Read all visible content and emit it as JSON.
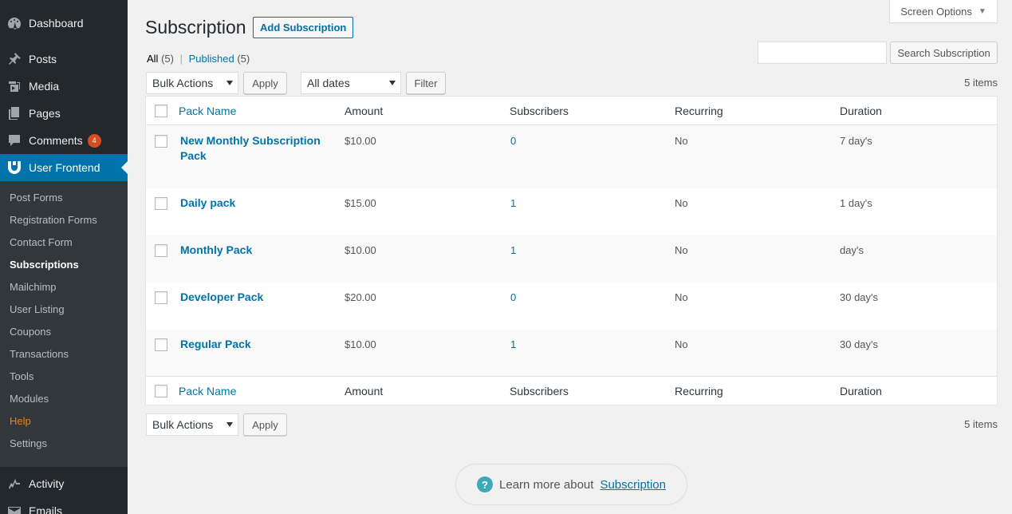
{
  "sidebar": {
    "menu": [
      {
        "label": "Dashboard",
        "icon": "dashboard-icon"
      },
      {
        "label": "Posts",
        "icon": "pin-icon"
      },
      {
        "label": "Media",
        "icon": "media-icon"
      },
      {
        "label": "Pages",
        "icon": "pages-icon"
      },
      {
        "label": "Comments",
        "icon": "comment-icon",
        "badge": "4"
      },
      {
        "label": "User Frontend",
        "icon": "user-frontend-icon"
      }
    ],
    "submenu": [
      "Post Forms",
      "Registration Forms",
      "Contact Form",
      "Subscriptions",
      "Mailchimp",
      "User Listing",
      "Coupons",
      "Transactions",
      "Tools",
      "Modules",
      "Help",
      "Settings"
    ],
    "bottom_menu": [
      {
        "label": "Activity",
        "icon": "activity-icon"
      },
      {
        "label": "Emails",
        "icon": "email-icon"
      }
    ]
  },
  "header": {
    "screen_options": "Screen Options",
    "title": "Subscription",
    "add_new": "Add Subscription"
  },
  "views": {
    "all": "All",
    "all_count": "(5)",
    "separator": "|",
    "published": "Published",
    "published_count": "(5)"
  },
  "search": {
    "value": "",
    "button": "Search Subscription"
  },
  "tablenav_top": {
    "bulk_actions": "Bulk Actions",
    "apply": "Apply",
    "dates": "All dates",
    "filter": "Filter",
    "items": "5 items"
  },
  "tablenav_bottom": {
    "bulk_actions": "Bulk Actions",
    "apply": "Apply",
    "items": "5 items"
  },
  "table": {
    "columns": [
      "Pack Name",
      "Amount",
      "Subscribers",
      "Recurring",
      "Duration"
    ],
    "rows": [
      {
        "name": "New Monthly Subscription Pack",
        "amount": "$10.00",
        "subscribers": "0",
        "recurring": "No",
        "duration": "7 day's"
      },
      {
        "name": "Daily pack",
        "amount": "$15.00",
        "subscribers": "1",
        "recurring": "No",
        "duration": "1 day's"
      },
      {
        "name": "Monthly Pack",
        "amount": "$10.00",
        "subscribers": "1",
        "recurring": "No",
        "duration": "day's"
      },
      {
        "name": "Developer Pack",
        "amount": "$20.00",
        "subscribers": "0",
        "recurring": "No",
        "duration": "30 day's"
      },
      {
        "name": "Regular Pack",
        "amount": "$10.00",
        "subscribers": "1",
        "recurring": "No",
        "duration": "30 day's"
      }
    ]
  },
  "learn_more": {
    "text": "Learn more about",
    "link": "Subscription"
  },
  "colors": {
    "sidebar_bg": "#23282d",
    "submenu_bg": "#32373c",
    "accent": "#0073aa",
    "badge": "#d54e21",
    "help": "#f18500"
  }
}
